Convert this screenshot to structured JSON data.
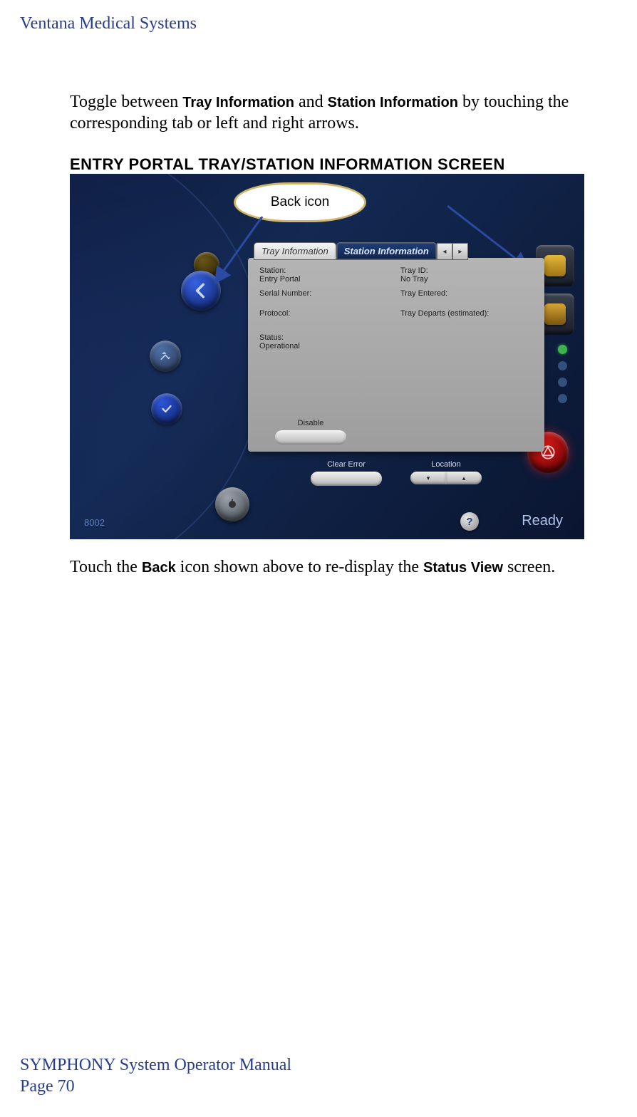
{
  "header": {
    "company": "Ventana Medical Systems"
  },
  "body": {
    "para1_a": "Toggle between ",
    "para1_b1": "Tray Information",
    "para1_c": " and ",
    "para1_b2": "Station Information",
    "para1_d": " by touching the corresponding tab or left and right arrows.",
    "section_title": "ENTRY PORTAL TRAY/STATION INFORMATION SCREEN",
    "para2_a": "Touch the ",
    "para2_b1": "Back",
    "para2_c": " icon shown above to re-display the ",
    "para2_b2": "Status View",
    "para2_d": " screen."
  },
  "ui": {
    "callout_label": "Back icon",
    "tabs": {
      "tray": "Tray Information",
      "station": "Station Information"
    },
    "labels": {
      "station": "Station:",
      "station_val": "Entry Portal",
      "serial": "Serial Number:",
      "protocol": "Protocol:",
      "status": "Status:",
      "status_val": "Operational",
      "trayid": "Tray ID:",
      "trayid_val": "No Tray",
      "entered": "Tray Entered:",
      "departs": "Tray Departs (estimated):"
    },
    "buttons": {
      "disable": "Disable",
      "clear_error": "Clear Error",
      "location": "Location"
    },
    "status_code": "8002",
    "ready": "Ready",
    "help": "?"
  },
  "footer": {
    "manual": "SYMPHONY System Operator Manual",
    "page": "Page 70"
  }
}
